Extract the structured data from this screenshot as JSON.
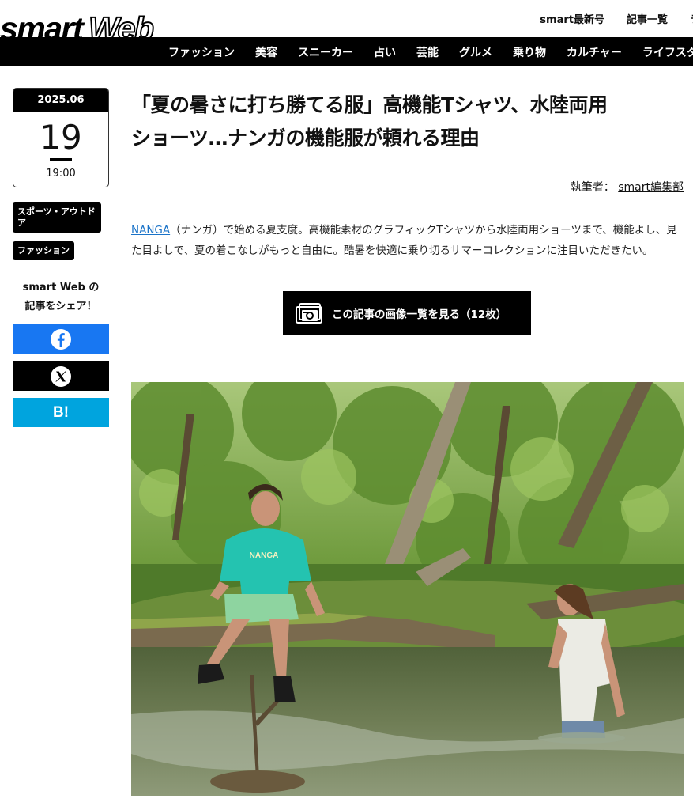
{
  "header": {
    "logo_left": "smart",
    "logo_right": "Web",
    "top_links": [
      "smart最新号",
      "記事一覧",
      "ラ"
    ],
    "nav": [
      "ファッション",
      "美容",
      "スニーカー",
      "占い",
      "芸能",
      "グルメ",
      "乗り物",
      "カルチャー",
      "ライフスタ"
    ]
  },
  "sidebar": {
    "date": {
      "year_month": "2025.06",
      "day": "19",
      "time": "19:00"
    },
    "tags": [
      "スポーツ・アウトドア",
      "ファッション"
    ],
    "share_title_1": "smart Web の",
    "share_title_2": "記事をシェア！",
    "share_hatena": "B!"
  },
  "article": {
    "title_line1": "「夏の暑さに打ち勝てる服」高機能Tシャツ、水陸両用",
    "title_line2": "ショーツ…ナンガの機能服が頼れる理由",
    "author_label": "執筆者：",
    "author_name": "smart編集部",
    "lead_link": "NANGA",
    "lead_text": "（ナンガ）で始める夏支度。高機能素材のグラフィックTシャツから水陸両用ショーツまで、機能よし、見た目よしで、夏の着こなしがもっと自由に。酷暑を快適に乗り切るサマーコレクションに注目いただきたい。",
    "gallery_button": "この記事の画像一覧を見る（12枚）"
  },
  "hero_image": {
    "shirt_text": "NANGA"
  },
  "colors": {
    "facebook": "#1877f2",
    "hatena": "#00a4de",
    "link": "#1a73c8",
    "nav_bg": "#000000"
  },
  "icons": [
    "facebook-icon",
    "x-icon",
    "camera-icon"
  ]
}
